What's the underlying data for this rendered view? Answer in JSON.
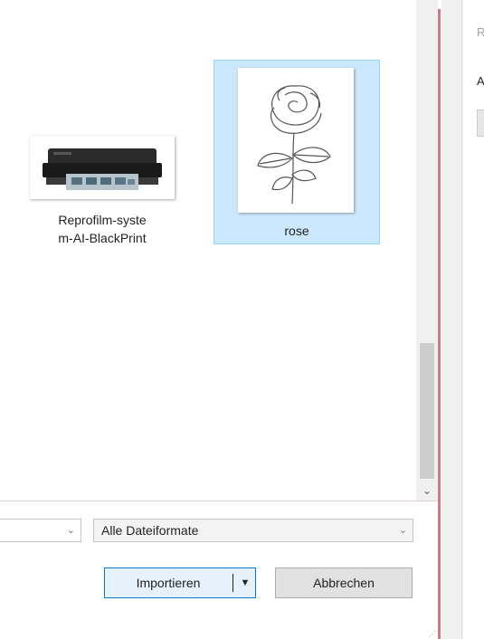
{
  "files": [
    {
      "name": "Reprofilm-syste\nm-AI-BlackPrint",
      "line1": "Reprofilm-syste",
      "line2": "m-AI-BlackPrint",
      "icon": "printer-thumbnail",
      "selected": false
    },
    {
      "name": "rose",
      "icon": "rose-sketch-thumbnail",
      "selected": true
    }
  ],
  "filter": {
    "left_value": "",
    "format_value": "Alle Dateiformate"
  },
  "buttons": {
    "import": "Importieren",
    "cancel": "Abbrechen"
  },
  "right_panel": {
    "label_top": "R",
    "label_second": "A"
  },
  "colors": {
    "selection_bg": "#cce8ff",
    "selection_border": "#99d1ff",
    "dialog_border": "#c97b8b",
    "primary_button_border": "#0078d7"
  }
}
